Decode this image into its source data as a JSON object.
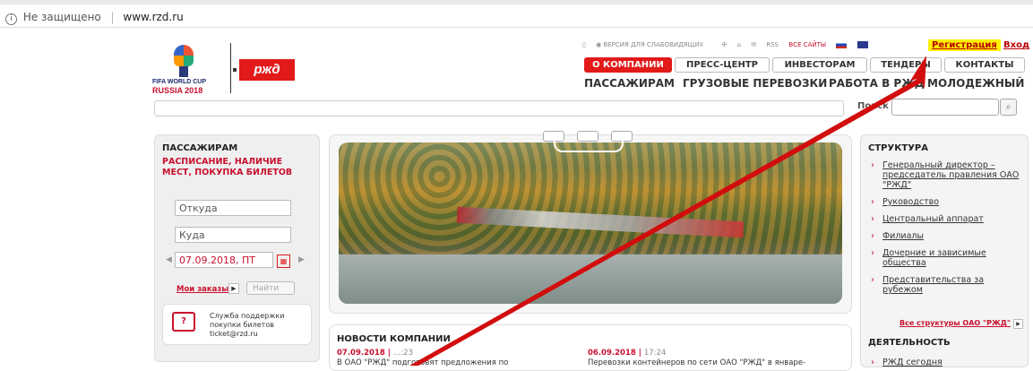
{
  "addressbar": {
    "security": "Не защищено",
    "url": "www.rzd.ru"
  },
  "logo": {
    "fifa_line1": "FIFA WORLD CUP",
    "fifa_line2": "RUSSIA 2018",
    "rzd": "рждǝ"
  },
  "utility": {
    "vision_label": "ВЕРСИЯ ДЛЯ СЛАБОВИДЯЩИХ",
    "rss": "RSS",
    "all_sites": "ВСЕ САЙТЫ",
    "register": "Регистрация",
    "login": "Вход",
    "highlight_color": "#fff200"
  },
  "topnav": [
    "О КОМПАНИИ",
    "ПРЕСС-ЦЕНТР",
    "ИНВЕСТОРАМ",
    "ТЕНДЕРЫ",
    "КОНТАКТЫ"
  ],
  "mainnav": [
    "ПАССАЖИРАМ",
    "ГРУЗОВЫЕ ПЕРЕВОЗКИ",
    "РАБОТА В РЖД",
    "МОЛОДЕЖНЫЙ"
  ],
  "search": {
    "label": "Поиск",
    "value": ""
  },
  "booking": {
    "title": "ПАССАЖИРАМ",
    "subtitle": "РАСПИСАНИЕ, НАЛИЧИЕ МЕСТ, ПОКУПКА БИЛЕТОВ",
    "from_placeholder": "Откуда",
    "to_placeholder": "Куда",
    "date": "07.09.2018, ПТ",
    "my_orders": "Мои заказы",
    "find": "Найти",
    "support_line1": "Служба поддержки",
    "support_line2": "покупки билетов",
    "support_line3": "ticket@rzd.ru"
  },
  "news": {
    "title": "НОВОСТИ КОМПАНИИ",
    "item1_date": "07.09.2018 |",
    "item1_time": "…:23",
    "item1_text": "В ОАО \"РЖД\" подготовят предложения по",
    "item2_date": "06.09.2018 |",
    "item2_time": "17:24",
    "item2_text": "Перевозки контейнеров по сети ОАО \"РЖД\" в январе-"
  },
  "structure": {
    "title": "СТРУКТУРА",
    "items": [
      "Генеральный директор – председатель правления ОАО \"РЖД\"",
      "Руководство",
      "Центральный аппарат",
      "Филиалы",
      "Дочерние и зависимые общества",
      "Представительства за рубежом"
    ],
    "all": "Все структуры ОАО \"РЖД\"",
    "activity_title": "ДЕЯТЕЛЬНОСТЬ",
    "activity_first": "РЖД сегодня"
  },
  "colors": {
    "brand": "#e21a1a",
    "arrow": "#d10d0d"
  }
}
